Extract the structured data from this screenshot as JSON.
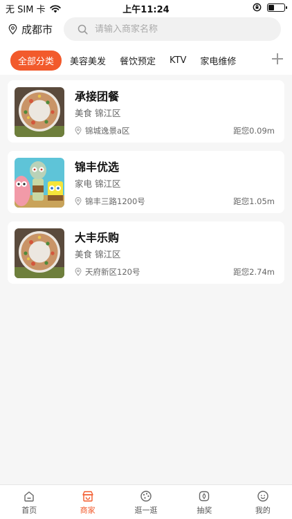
{
  "status_bar": {
    "carrier": "无 SIM 卡",
    "time": "上午11:24",
    "battery_level": 0.35
  },
  "header": {
    "city": "成都市",
    "search_placeholder": "请输入商家名称"
  },
  "tabs": [
    {
      "label": "全部分类",
      "active": true
    },
    {
      "label": "美容美发",
      "active": false
    },
    {
      "label": "餐饮预定",
      "active": false
    },
    {
      "label": "KTV",
      "active": false
    },
    {
      "label": "家电维修",
      "active": false
    }
  ],
  "merchants": [
    {
      "name": "承接团餐",
      "category": "美食 锦江区",
      "address": "锦城逸景a区",
      "distance": "距您0.09m",
      "image": "food-wreath"
    },
    {
      "name": "锦丰优选",
      "category": "家电 锦江区",
      "address": "锦丰三路1200号",
      "distance": "距您1.05m",
      "image": "cartoon-characters"
    },
    {
      "name": "大丰乐购",
      "category": "美食 锦江区",
      "address": "天府新区120号",
      "distance": "距您2.74m",
      "image": "food-wreath"
    }
  ],
  "bottom_nav": [
    {
      "label": "首页",
      "icon": "home-icon",
      "active": false
    },
    {
      "label": "商家",
      "icon": "shop-icon",
      "active": true
    },
    {
      "label": "逛一逛",
      "icon": "explore-icon",
      "active": false
    },
    {
      "label": "抽奖",
      "icon": "lottery-icon",
      "active": false
    },
    {
      "label": "我的",
      "icon": "profile-icon",
      "active": false
    }
  ],
  "colors": {
    "accent": "#f25a2c",
    "background": "#f6f6f6"
  }
}
